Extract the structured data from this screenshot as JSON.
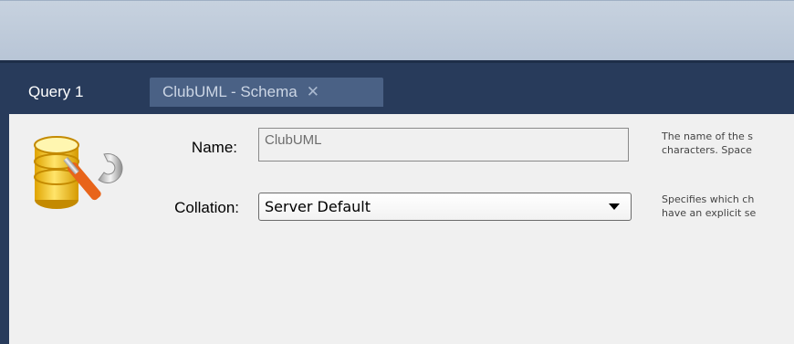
{
  "tabs": [
    {
      "label": "Query 1"
    },
    {
      "label": "ClubUML - Schema",
      "close_glyph": "✕"
    }
  ],
  "form": {
    "name_label": "Name:",
    "name_value": "ClubUML",
    "collation_label": "Collation:",
    "collation_value": "Server Default"
  },
  "help": {
    "name_line1": "The name of the s",
    "name_line2": "characters. Space",
    "collation_line1": "Specifies which ch",
    "collation_line2": "have an explicit se"
  },
  "icons": {
    "schema_icon": "database-wrench-icon",
    "close_icon": "close-icon",
    "dropdown_icon": "chevron-down-icon"
  },
  "colors": {
    "tabstrip": "#283b5b",
    "active_tab": "#4a6185",
    "topbar": "#c0ccda"
  }
}
